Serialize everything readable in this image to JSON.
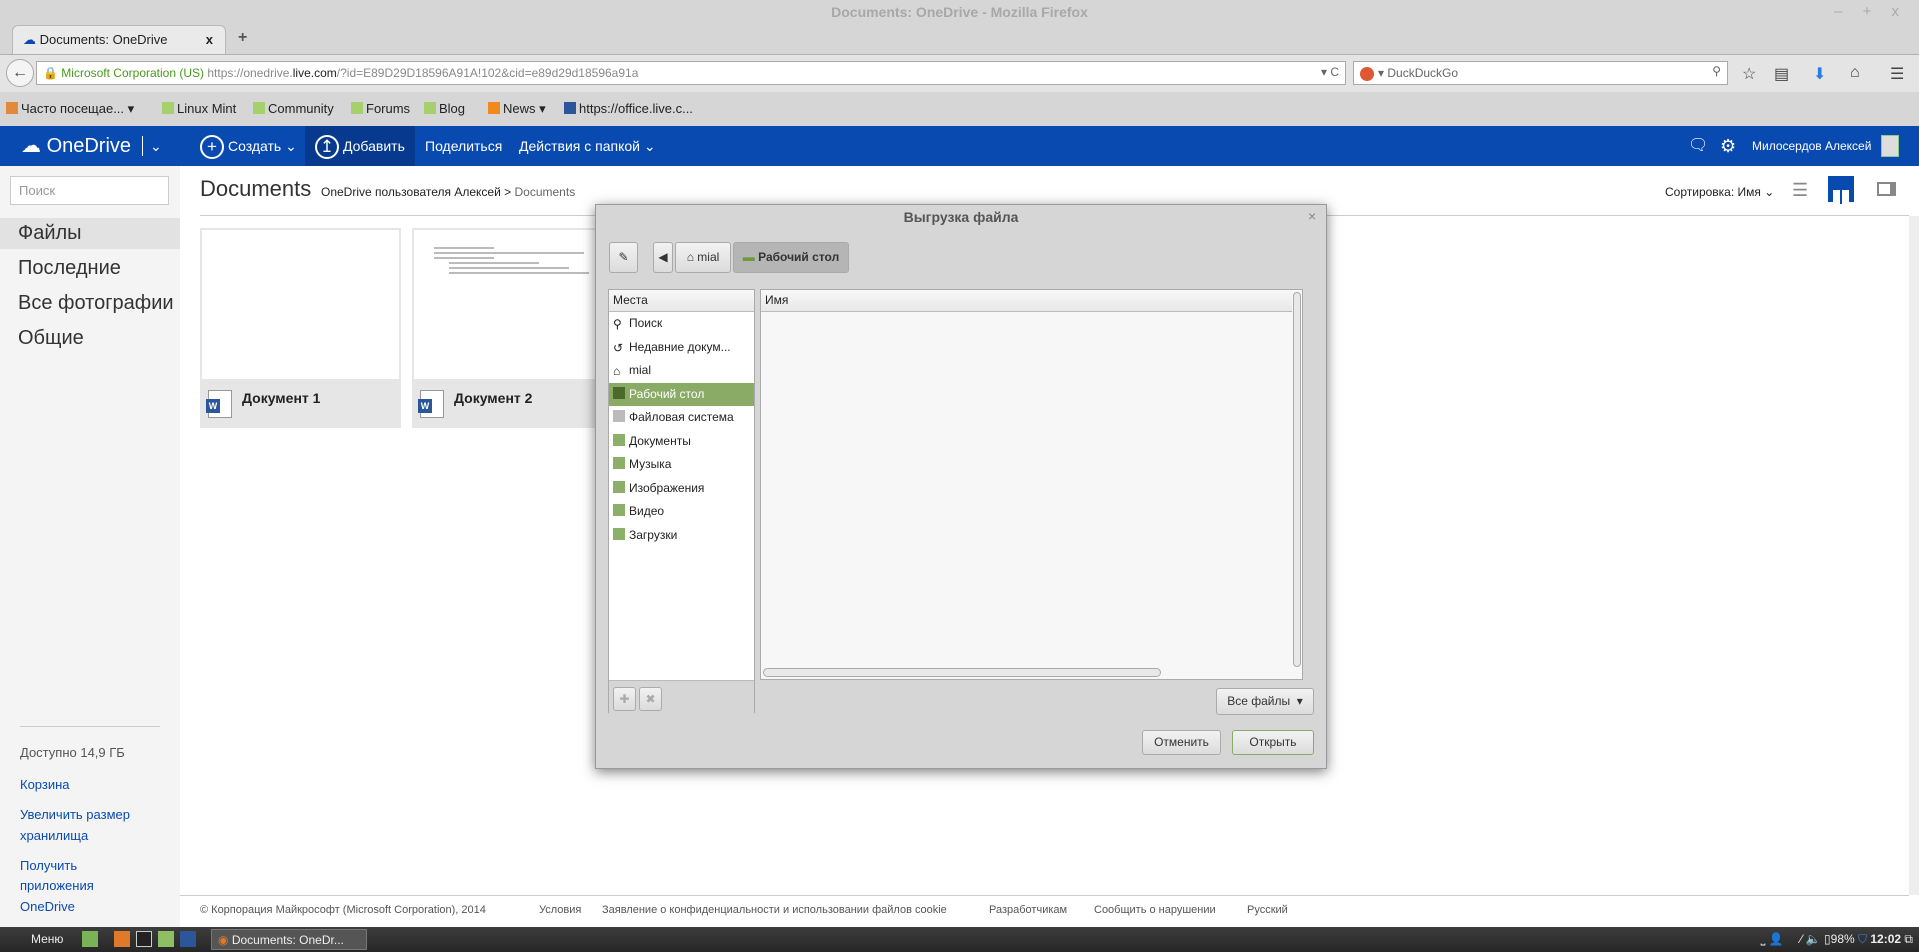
{
  "window": {
    "title": "Documents: OneDrive - Mozilla Firefox",
    "controls": "– + x"
  },
  "tab": {
    "label": "Documents: OneDrive",
    "close": "x",
    "new": "+"
  },
  "urlbar": {
    "identity": "Microsoft Corporation (US)",
    "url_prefix": "https://onedrive.",
    "url_host": "live.com",
    "url_rest": "/?id=E89D29D18596A91A!102&cid=e89d29d18596a91a",
    "reload": "▾ C"
  },
  "searchbar": {
    "engine": "DuckDuckGo"
  },
  "bookmarks": [
    "Часто посещае... ▾",
    "Linux Mint",
    "Community",
    "Forums",
    "Blog",
    "News ▾",
    "https://office.live.c..."
  ],
  "onedrive": {
    "brand": "OneDrive",
    "create": "Создать",
    "add": "Добавить",
    "share": "Поделиться",
    "folder_actions": "Действия с папкой",
    "user": "Милосердов Алексей"
  },
  "sidebar": {
    "search_placeholder": "Поиск",
    "items": [
      "Файлы",
      "Последние",
      "Все фотографии",
      "Общие"
    ],
    "available": "Доступно 14,9 ГБ",
    "links": [
      "Корзина",
      "Увеличить размер",
      "хранилища",
      "Получить",
      "приложения",
      "OneDrive"
    ]
  },
  "main": {
    "title": "Documents",
    "breadcrumb_root": "OneDrive пользователя Алексей",
    "breadcrumb_sep": ">",
    "breadcrumb_current": "Documents",
    "sort": "Сортировка: Имя",
    "files": [
      "Документ 1",
      "Документ 2"
    ]
  },
  "footer": {
    "copyright": "© Корпорация Майкрософт (Microsoft Corporation), 2014",
    "links": [
      "Условия",
      "Заявление о конфиденциальности и использовании файлов cookie",
      "Разработчикам",
      "Сообщить о нарушении",
      "Русский"
    ]
  },
  "dialog": {
    "title": "Выгрузка файла",
    "close": "×",
    "path": [
      "mial",
      "Рабочий стол"
    ],
    "places_header": "Места",
    "places": [
      "Поиск",
      "Недавние докум...",
      "mial",
      "Рабочий стол",
      "Файловая система",
      "Документы",
      "Музыка",
      "Изображения",
      "Видео",
      "Загрузки"
    ],
    "selected_place": "Рабочий стол",
    "name_header": "Имя",
    "filter": "Все файлы",
    "cancel": "Отменить",
    "open": "Открыть"
  },
  "taskbar": {
    "menu": "Меню",
    "task": "Documents: OneDr...",
    "battery": "98%",
    "clock": "12:02"
  },
  "colors": {
    "brand": "#094ab1",
    "selection": "#8aab66"
  }
}
